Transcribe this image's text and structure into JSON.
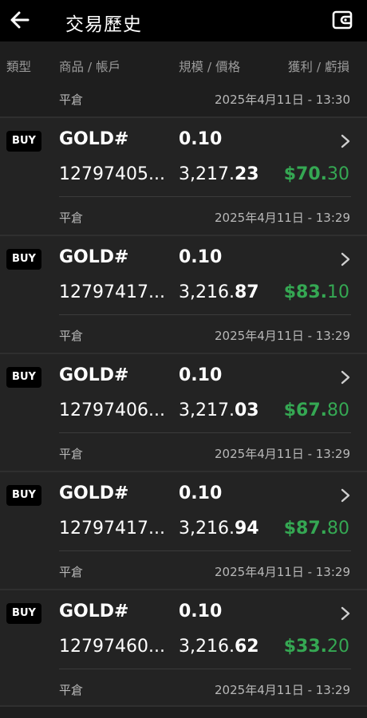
{
  "header": {
    "title": "交易歷史",
    "back_icon": "arrow-left-icon",
    "wallet_icon": "wallet-icon"
  },
  "columns": {
    "type": "類型",
    "product": "商品 / 帳戶",
    "size": "規模 / 價格",
    "profit": "獲利 / 虧損"
  },
  "top_row": {
    "action": "平倉",
    "time": "2025年4月11日 - 13:30"
  },
  "colors": {
    "profit_green": "#35a853",
    "background": "#1e1e1e",
    "appbar": "#000000"
  },
  "deals": [
    {
      "side": "BUY",
      "symbol": "GOLD#",
      "volume": "0.10",
      "account": "12797405...",
      "price_main": "3,217.",
      "price_frac": "23",
      "profit_main": "$70.",
      "profit_frac": "30",
      "action": "平倉",
      "time": "2025年4月11日 - 13:29"
    },
    {
      "side": "BUY",
      "symbol": "GOLD#",
      "volume": "0.10",
      "account": "12797417...",
      "price_main": "3,216.",
      "price_frac": "87",
      "profit_main": "$83.",
      "profit_frac": "10",
      "action": "平倉",
      "time": "2025年4月11日 - 13:29"
    },
    {
      "side": "BUY",
      "symbol": "GOLD#",
      "volume": "0.10",
      "account": "12797406...",
      "price_main": "3,217.",
      "price_frac": "03",
      "profit_main": "$67.",
      "profit_frac": "80",
      "action": "平倉",
      "time": "2025年4月11日 - 13:29"
    },
    {
      "side": "BUY",
      "symbol": "GOLD#",
      "volume": "0.10",
      "account": "12797417...",
      "price_main": "3,216.",
      "price_frac": "94",
      "profit_main": "$87.",
      "profit_frac": "80",
      "action": "平倉",
      "time": "2025年4月11日 - 13:29"
    },
    {
      "side": "BUY",
      "symbol": "GOLD#",
      "volume": "0.10",
      "account": "12797460...",
      "price_main": "3,216.",
      "price_frac": "62",
      "profit_main": "$33.",
      "profit_frac": "20",
      "action": "平倉",
      "time": "2025年4月11日 - 13:29"
    }
  ]
}
